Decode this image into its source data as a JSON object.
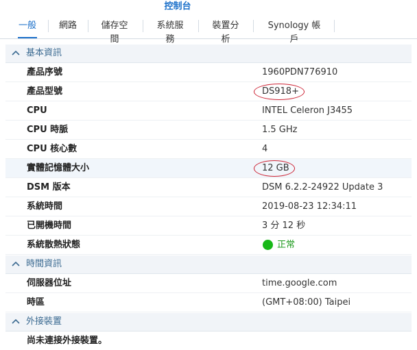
{
  "window": {
    "title": "控制台"
  },
  "tabs": [
    {
      "label": "一般"
    },
    {
      "label": "網路"
    },
    {
      "label": "儲存空間"
    },
    {
      "label": "系統服務"
    },
    {
      "label": "裝置分析"
    },
    {
      "label": "Synology 帳戶"
    }
  ],
  "sections": [
    {
      "title": "基本資訊",
      "rows": [
        {
          "label": "產品序號",
          "value": "1960PDN776910"
        },
        {
          "label": "產品型號",
          "value": "DS918+"
        },
        {
          "label": "CPU",
          "value": "INTEL Celeron J3455"
        },
        {
          "label": "CPU 時脈",
          "value": "1.5 GHz"
        },
        {
          "label": "CPU 核心數",
          "value": "4"
        },
        {
          "label": "實體記憶體大小",
          "value": "12 GB"
        },
        {
          "label": "DSM 版本",
          "value": "DSM 6.2.2-24922 Update 3"
        },
        {
          "label": "系統時間",
          "value": "2019-08-23 12:34:11"
        },
        {
          "label": "已開機時間",
          "value": "3 分 12 秒"
        },
        {
          "label": "系統散熱狀態",
          "value": "正常"
        }
      ]
    },
    {
      "title": "時間資訊",
      "rows": [
        {
          "label": "伺服器位址",
          "value": "time.google.com"
        },
        {
          "label": "時區",
          "value": "(GMT+08:00) Taipei"
        }
      ]
    },
    {
      "title": "外接裝置",
      "note": "尚未連接外接裝置。"
    }
  ],
  "colors": {
    "accent": "#1a6fc9",
    "ok": "#18b818",
    "annotation": "#cc2233"
  },
  "icons": {
    "section_toggle": "chevron-up-icon",
    "status_ok": "status-dot-icon"
  }
}
